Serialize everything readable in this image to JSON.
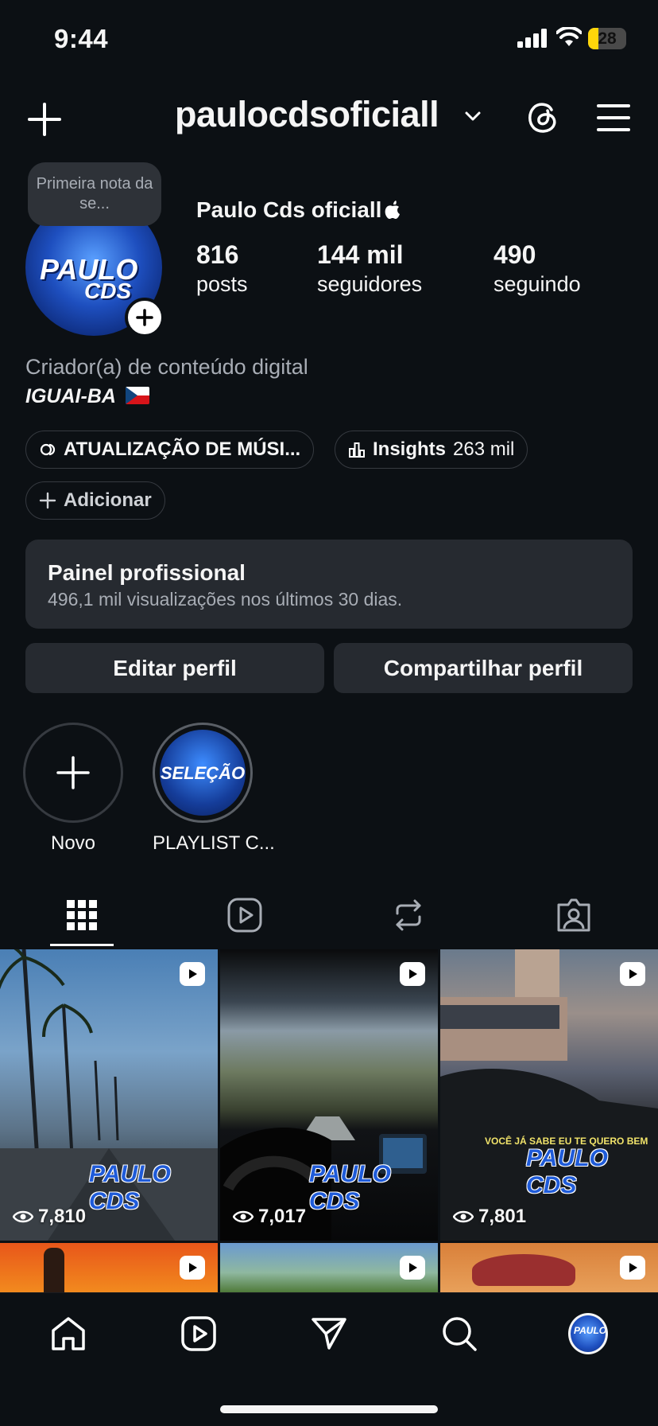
{
  "status_bar": {
    "time": "9:44",
    "battery_percent": "28",
    "battery_level": 0.28,
    "battery_color": "#ffd60a"
  },
  "header": {
    "username": "paulocdsoficiall",
    "icons": [
      "plus-icon",
      "chevron-down-icon",
      "threads-icon",
      "menu-icon"
    ]
  },
  "profile": {
    "note": "Primeira nota da se...",
    "display_name": "Paulo Cds oficiall",
    "stats": [
      {
        "value": "816",
        "label": "posts"
      },
      {
        "value": "144 mil",
        "label": "seguidores"
      },
      {
        "value": "490",
        "label": "seguindo"
      }
    ],
    "category": "Criador(a) de conteúdo digital",
    "location": "IGUAI-BA",
    "flag": "czech-flag",
    "avatar_text_1": "PAULO",
    "avatar_text_2": "CDS"
  },
  "chips": {
    "update": "ATUALIZAÇÃO DE MÚSI...",
    "insights_label": "Insights",
    "insights_count": "263 mil",
    "add": "Adicionar"
  },
  "professional_panel": {
    "title": "Painel profissional",
    "subtitle": "496,1 mil visualizações nos últimos 30 dias."
  },
  "buttons": {
    "edit": "Editar perfil",
    "share": "Compartilhar perfil"
  },
  "highlights": [
    {
      "label": "Novo"
    },
    {
      "label": "PLAYLIST C...",
      "cover_text": "SELEÇÃO"
    }
  ],
  "tabs": [
    "grid",
    "reels",
    "reposts",
    "tagged"
  ],
  "grid": [
    {
      "views": "7,810",
      "watermark": "PAULO CDS"
    },
    {
      "views": "7,017",
      "watermark": "PAULO CDS"
    },
    {
      "views": "7,801",
      "watermark": "PAULO CDS",
      "caption": "VOCÊ JÁ SABE EU TE QUERO BEM"
    },
    {
      "views": ""
    },
    {
      "views": ""
    },
    {
      "views": ""
    }
  ],
  "bottom_nav": [
    "home",
    "reels",
    "direct",
    "search",
    "profile"
  ],
  "colors": {
    "background": "#0c1014",
    "surface": "#262a30",
    "text": "#f5f5f5",
    "secondary_text": "#a8adb5"
  }
}
